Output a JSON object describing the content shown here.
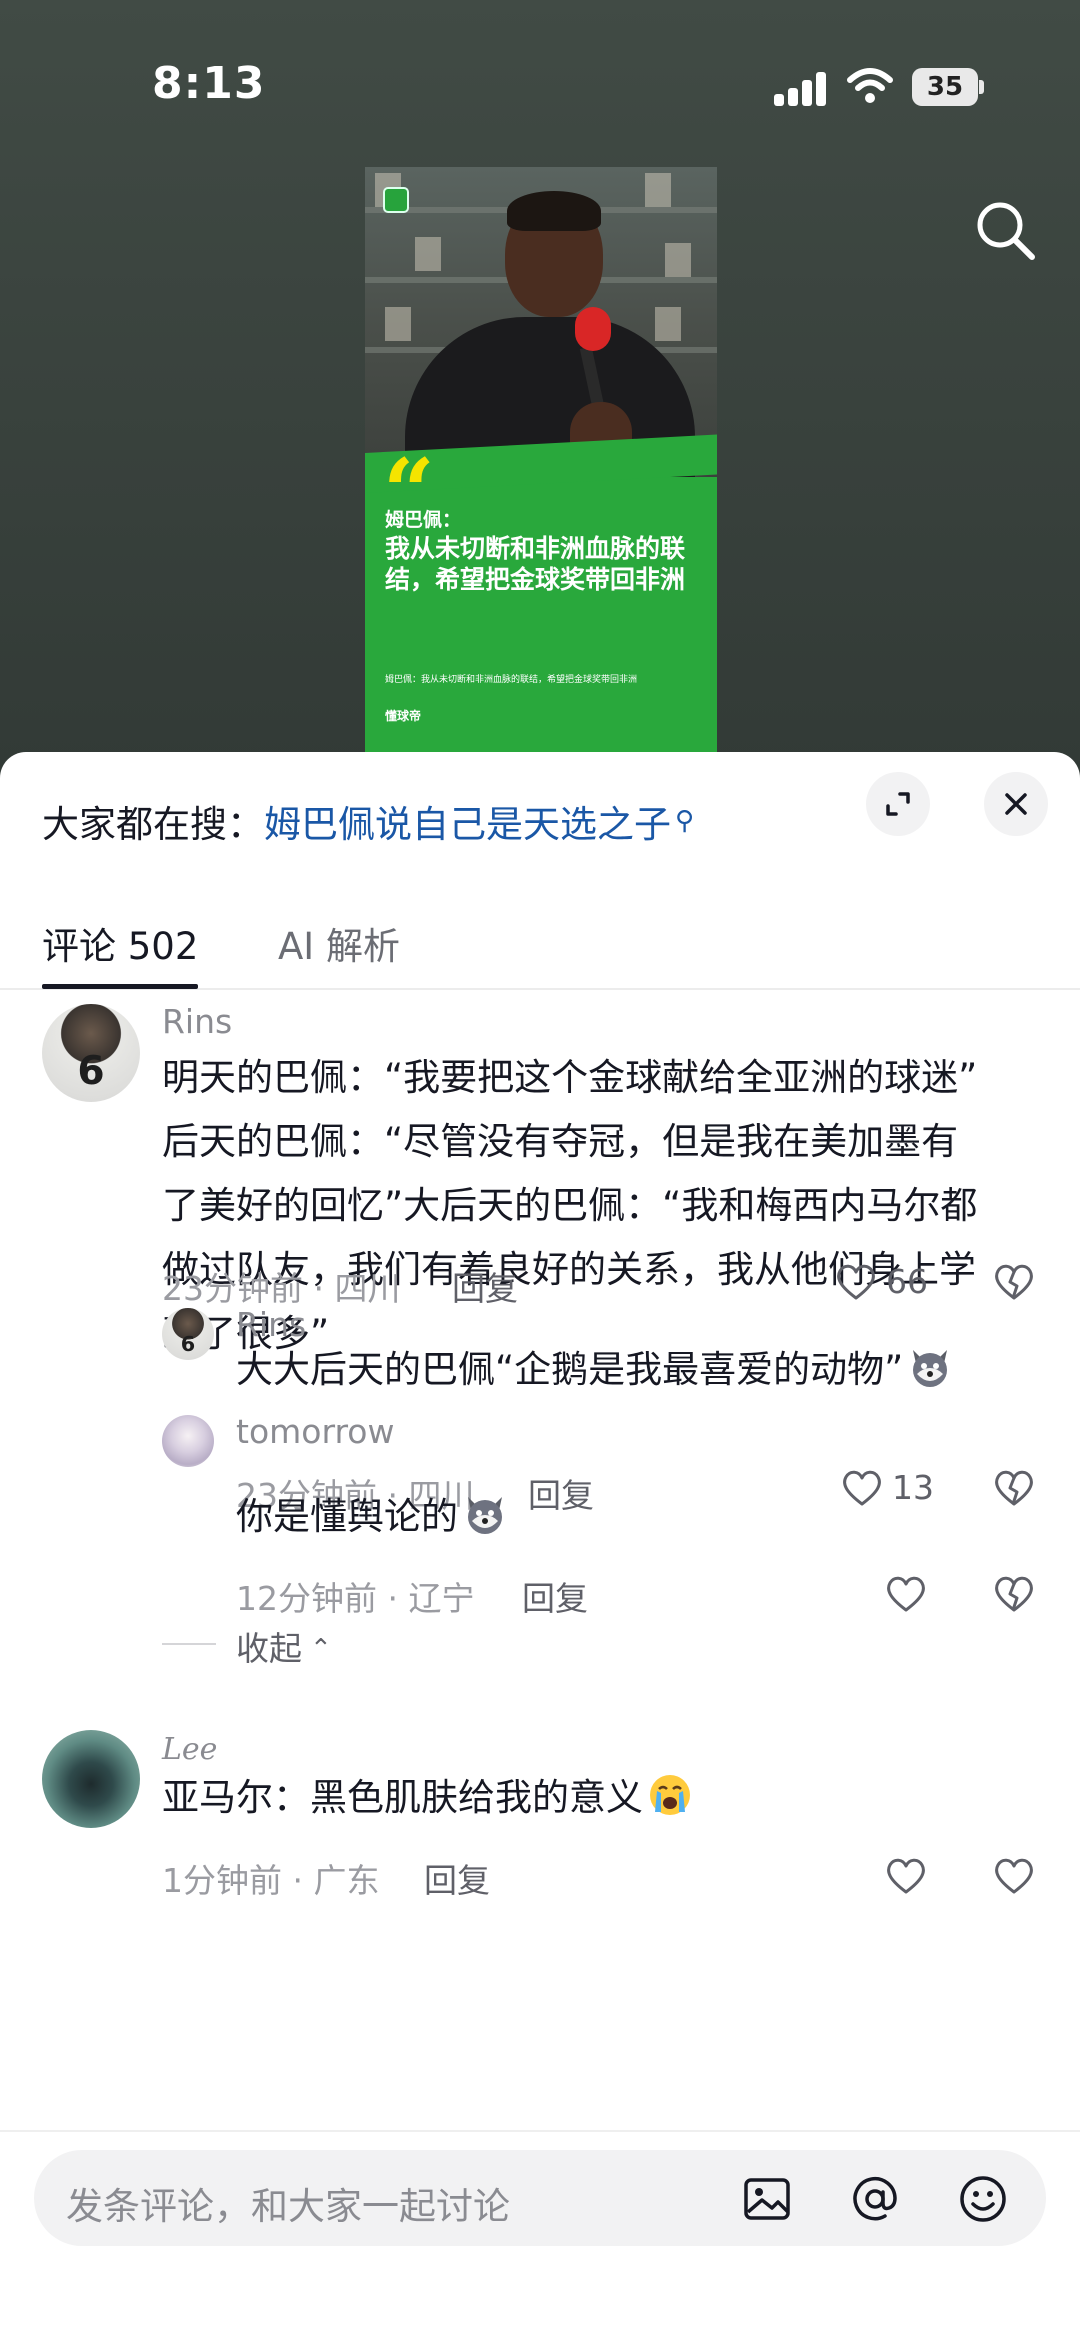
{
  "status_bar": {
    "time": "8:13",
    "battery": "35"
  },
  "video": {
    "thumbnail": {
      "name_line": "姆巴佩：",
      "headline": "我从未切断和非洲血脉的联结，希望把金球奖带回非洲",
      "small_caption": "姆巴佩：我从未切断和非洲血脉的联结，希望把金球奖带回非洲",
      "brand": "懂球帝"
    }
  },
  "sheet": {
    "hot_search_prefix": "大家都在搜：",
    "hot_search_term": "姆巴佩说自己是天选之子",
    "tabs": [
      {
        "label": "评论 502"
      },
      {
        "label": "AI 解析"
      }
    ],
    "comments": [
      {
        "user": "Rins",
        "text_lines": [
          "明天的巴佩：“我要把这个金球献给全亚洲的球迷”",
          "后天的巴佩：“尽管没有夺冠，但是我在美加墨有",
          "了美好的回忆”大后天的巴佩：“我和梅西内马尔都",
          "做过队友，我们有着良好的关系，我从他们身上学",
          "到了很多”"
        ],
        "meta": "23分钟前 · 四川",
        "reply": "回复",
        "likes": "66"
      }
    ],
    "replies": [
      {
        "user": "Rins",
        "text": "大大后天的巴佩“企鹅是我最喜爱的动物”",
        "meta": "23分钟前 · 四川",
        "reply": "回复",
        "likes": "13"
      },
      {
        "user": "tomorrow",
        "text": "你是懂舆论的",
        "meta": "12分钟前 · 辽宁",
        "reply": "回复"
      }
    ],
    "collapse_label": "收起",
    "comment2": {
      "user": "Lee",
      "text": "亚马尔：黑色肌肤给我的意义",
      "meta_partial": "1分钟前 · 广东",
      "reply": "回复"
    },
    "input_placeholder": "发条评论，和大家一起讨论"
  },
  "icons": {
    "search": "search-icon",
    "expand": "expand-icon",
    "close": "close-icon",
    "image": "image-icon",
    "mention": "at-icon",
    "emoji": "emoji-icon"
  },
  "colors": {
    "hot_term": "#1a57a6",
    "thumbnail_green": "#29a83c",
    "quote_yellow": "#f5e400"
  }
}
